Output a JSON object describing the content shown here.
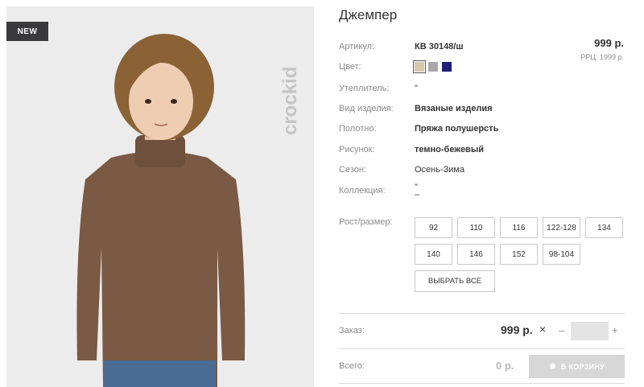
{
  "product": {
    "badge": "NEW",
    "brand_watermark": "crockid",
    "title": "Джемпер",
    "price": "999 р.",
    "rrp": "РРЦ: 1999 р."
  },
  "specs": [
    {
      "label": "Артикул:",
      "value": "КВ 30148/ш"
    },
    {
      "label": "Цвет:",
      "value": ""
    },
    {
      "label": "Утеплитель:",
      "value": "\""
    },
    {
      "label": "Вид изделия:",
      "value": "Вязаные изделия"
    },
    {
      "label": "Полотно:",
      "value": "Пряжа полушерсть"
    },
    {
      "label": "Рисунок:",
      "value": "темно-бежевый"
    },
    {
      "label": "Сезон:",
      "value": "Осень-Зима"
    },
    {
      "label": "Коллекция:",
      "value": "\"\n–"
    }
  ],
  "colors": [
    "#d8c8aa",
    "#a8a8a8",
    "#1f1f7a"
  ],
  "sizes": {
    "label": "Рост/размер:",
    "options": [
      "92",
      "110",
      "116",
      "122-128",
      "134",
      "140",
      "146",
      "152",
      "98-104"
    ],
    "select_all": "ВЫБРАТЬ ВСЕ"
  },
  "order": {
    "label": "Заказ:",
    "price": "999 р.",
    "times": "×",
    "minus": "–",
    "plus": "+",
    "quantity": ""
  },
  "total": {
    "label": "Всего:",
    "value": "0 р.",
    "cart_button": "В КОРЗИНУ"
  }
}
